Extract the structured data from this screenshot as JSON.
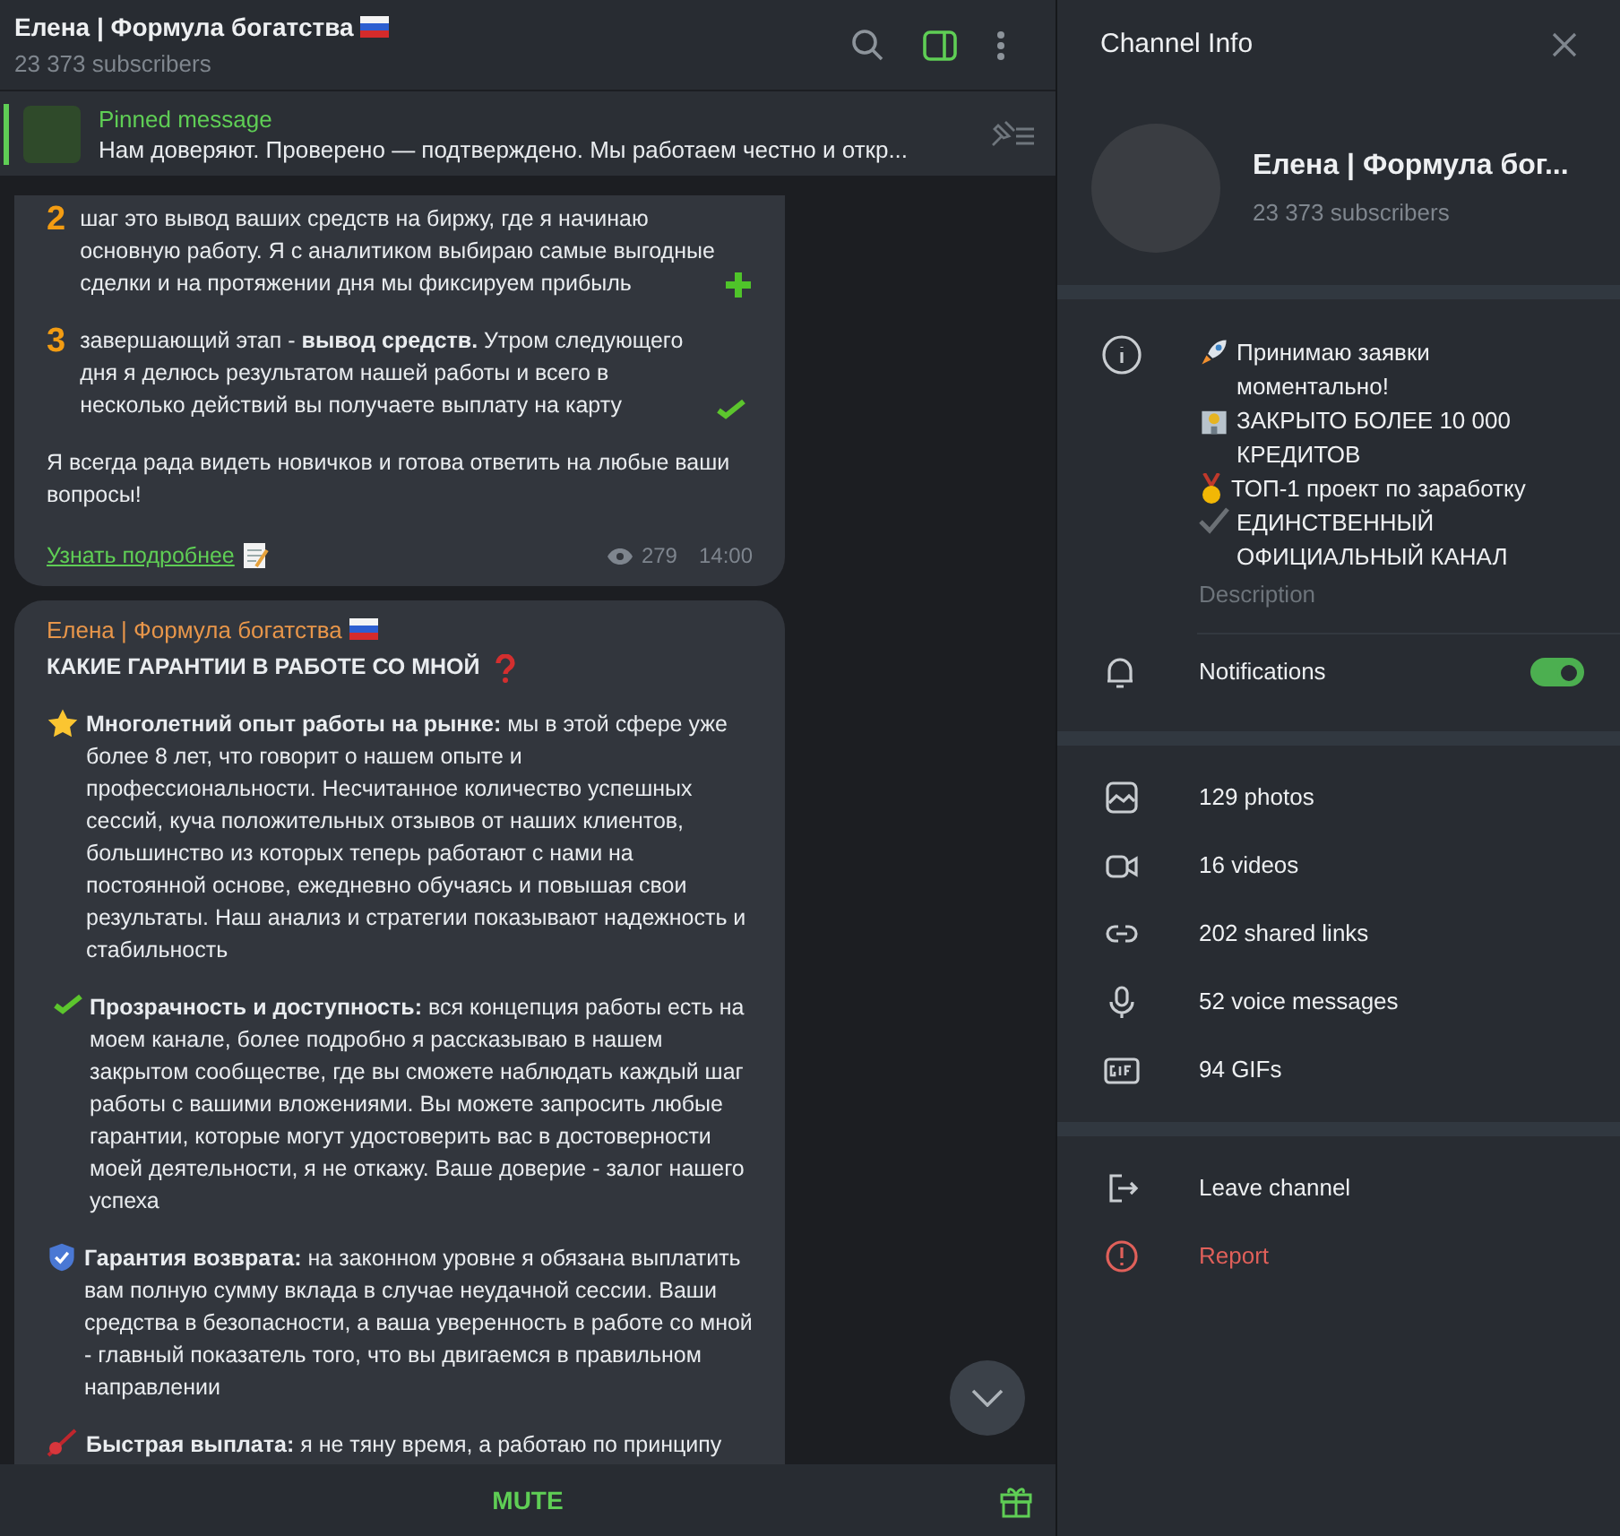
{
  "header": {
    "title": "Елена | Формула богатства",
    "subtitle": "23 373 subscribers",
    "side_panel_open": true
  },
  "pinned": {
    "label": "Pinned message",
    "text": "Нам доверяют. Проверено — подтверждено.  Мы работаем честно и откр..."
  },
  "messages": [
    {
      "paragraphs": [
        {
          "lead": {
            "kind": "digit",
            "text": "2"
          },
          "text": "шаг это вывод ваших средств на биржу, где я начинаю основную работу. Я с аналитиком выбираю самые выгодные сделки и на протяжении дня мы фиксируем прибыль",
          "trail": {
            "kind": "plus"
          }
        },
        {
          "lead": {
            "kind": "digit",
            "text": "3"
          },
          "text": "завершающий этап - **вывод средств.** Утром следующего дня я делюсь результатом нашей работы и всего в несколько действий вы получаете выплату на карту",
          "trail": {
            "kind": "check"
          }
        },
        {
          "text": "Я всегда рада видеть новичков и готова ответить на любые ваши вопросы!"
        }
      ],
      "link": "Узнать подробнее",
      "views": "279",
      "time": "14:00"
    },
    {
      "author": "Елена | Формула богатства",
      "paragraphs": [
        {
          "text": "**КАКИЕ ГАРАНТИИ В РАБОТЕ СО МНОЙ**",
          "trail": {
            "kind": "question"
          }
        },
        {
          "lead": {
            "kind": "star"
          },
          "text": "**Многолетний опыт работы на рынке:** мы в этой сфере уже более 8 лет, что говорит о нашем опыте и профессиональности. Несчитанное количество успешных сессий, куча положительных отзывов от наших клиентов, большинство из которых теперь работают с нами на постоянной основе, ежедневно обучаясь и повышая свои результаты. Наш анализ и стратегии показывают надежность и стабильность"
        },
        {
          "lead": {
            "kind": "check"
          },
          "text": "**Прозрачность и доступность:** вся концепция работы есть на моем канале, более подробно я рассказываю в нашем закрытом сообществе, где вы сможете наблюдать каждый шаг работы с вашими вложениями. Вы можете запросить любые гарантии, которые могут удостоверить вас в достоверности моей деятельности, я не откажу. Ваше доверие - залог нашего успеха"
        },
        {
          "lead": {
            "kind": "shield"
          },
          "text": "**Гарантия возврата:** на законном уровне я обязана выплатить вам полную сумму вклада в случае неудачной сессии. Ваши средства в безопасности, а ваша уверенность в работе со мной - главный показатель того, что вы двигаемся в правильном направлении"
        },
        {
          "lead": {
            "kind": "comet"
          },
          "text": "**Быстрая выплата:** я не тяну время, а работаю по принципу"
        }
      ]
    }
  ],
  "bottom_bar": {
    "button": "MUTE"
  },
  "info": {
    "title": "Channel Info",
    "name": "Елена | Формула бог...",
    "subscribers": "23 373 subscribers",
    "description": [
      {
        "kind": "rocket",
        "text": "Принимаю заявки моментально!"
      },
      {
        "kind": "bank",
        "text": "ЗАКРЫТО БОЛЕЕ 10 000 КРЕДИТОВ"
      },
      {
        "kind": "medal",
        "text": "ТОП-1 проект по заработку"
      },
      {
        "kind": "tick",
        "text": "ЕДИНСТВЕННЫЙ ОФИЦИАЛЬНЫЙ КАНАЛ"
      }
    ],
    "description_label": "Description",
    "notifications": {
      "label": "Notifications",
      "on": true
    },
    "media": [
      {
        "kind": "photos",
        "label": "129 photos"
      },
      {
        "kind": "videos",
        "label": "16 videos"
      },
      {
        "kind": "links",
        "label": "202 shared links"
      },
      {
        "kind": "voice",
        "label": "52 voice messages"
      },
      {
        "kind": "gifs",
        "label": "94 GIFs"
      }
    ],
    "actions": [
      {
        "kind": "leave",
        "label": "Leave channel"
      },
      {
        "kind": "report",
        "label": "Report"
      }
    ]
  }
}
